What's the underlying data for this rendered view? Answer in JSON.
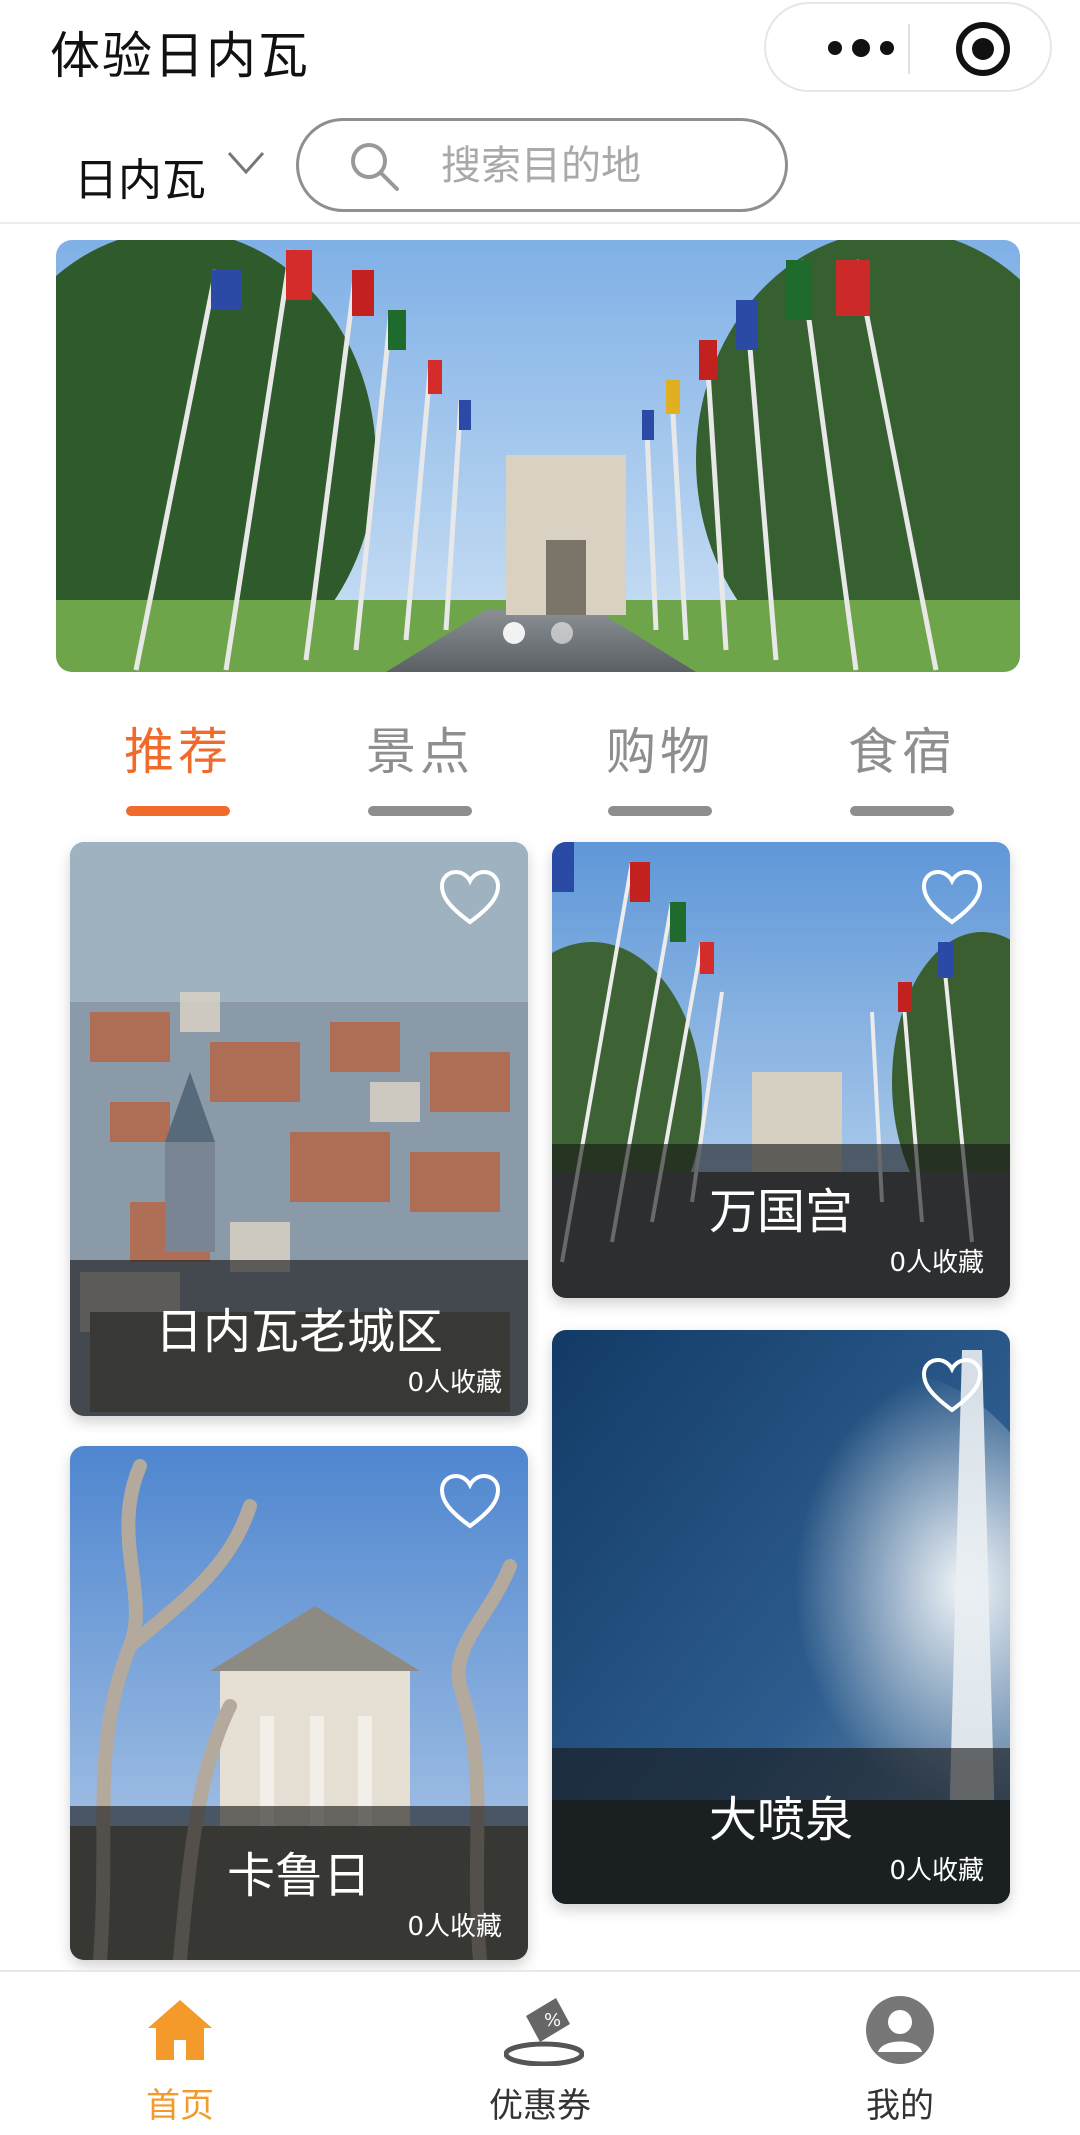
{
  "header": {
    "title": "体验日内瓦"
  },
  "location": {
    "city": "日内瓦"
  },
  "search": {
    "placeholder": "搜索目的地"
  },
  "banner": {
    "dots": 2,
    "active_dot": 0
  },
  "tabs": [
    {
      "label": "推荐",
      "active": true
    },
    {
      "label": "景点",
      "active": false
    },
    {
      "label": "购物",
      "active": false
    },
    {
      "label": "食宿",
      "active": false
    }
  ],
  "cards": [
    {
      "name": "日内瓦老城区",
      "favorites": "0人收藏"
    },
    {
      "name": "万国宫",
      "favorites": "0人收藏"
    },
    {
      "name": "卡鲁日",
      "favorites": "0人收藏"
    },
    {
      "name": "大喷泉",
      "favorites": "0人收藏"
    }
  ],
  "nav": [
    {
      "label": "首页",
      "icon": "home-icon",
      "active": true
    },
    {
      "label": "优惠券",
      "icon": "coupon-icon",
      "active": false
    },
    {
      "label": "我的",
      "icon": "user-icon",
      "active": false
    }
  ],
  "colors": {
    "accent": "#f06a2c",
    "nav_active": "#f39a2b",
    "inactive": "#8e8e8e"
  }
}
